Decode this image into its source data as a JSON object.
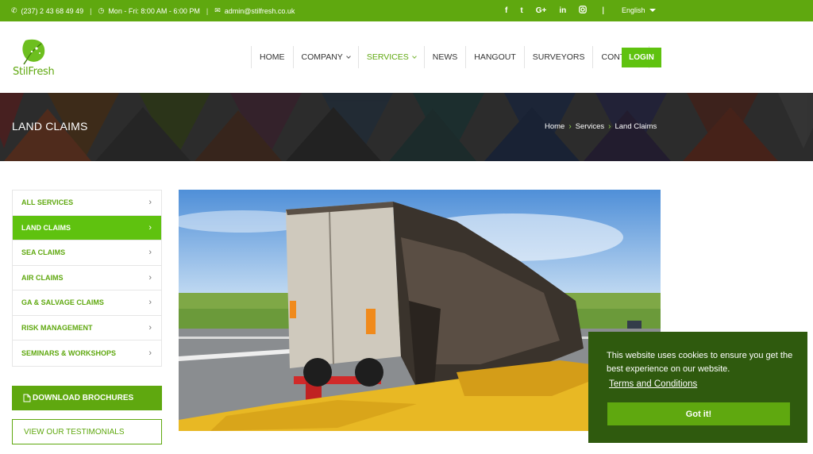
{
  "topbar": {
    "phone": "(237) 2 43 68 49 49",
    "hours": "Mon - Fri: 8:00 AM - 6:00 PM",
    "email": "admin@stilfresh.co.uk",
    "social": [
      "f",
      "t",
      "G+",
      "in",
      "ig"
    ],
    "language": "English"
  },
  "logo": {
    "text": "StilFresh"
  },
  "nav": {
    "items": [
      {
        "label": "HOME",
        "dropdown": false,
        "active": false
      },
      {
        "label": "COMPANY",
        "dropdown": true,
        "active": false
      },
      {
        "label": "SERVICES",
        "dropdown": true,
        "active": true
      },
      {
        "label": "NEWS",
        "dropdown": false,
        "active": false
      },
      {
        "label": "HANGOUT",
        "dropdown": false,
        "active": false
      },
      {
        "label": "SURVEYORS",
        "dropdown": false,
        "active": false
      },
      {
        "label": "CONTACT",
        "dropdown": false,
        "active": false
      }
    ],
    "login": "LOGIN"
  },
  "banner": {
    "title": "LAND CLAIMS",
    "breadcrumb": [
      "Home",
      "Services",
      "Land Claims"
    ]
  },
  "sidebar": {
    "items": [
      {
        "label": "ALL SERVICES",
        "active": false
      },
      {
        "label": "LAND CLAIMS",
        "active": true
      },
      {
        "label": "SEA CLAIMS",
        "active": false
      },
      {
        "label": "AIR CLAIMS",
        "active": false
      },
      {
        "label": "GA & SALVAGE CLAIMS",
        "active": false
      },
      {
        "label": "RISK MANAGEMENT",
        "active": false
      },
      {
        "label": "SEMINARS & WORKSHOPS",
        "active": false
      }
    ],
    "brochure": "DOWNLOAD BROCHURES",
    "testimonials": "VIEW OUR TESTIMONIALS"
  },
  "cookie": {
    "message": "This website uses cookies to ensure you get the best experience on our website.",
    "link": "Terms and Conditions",
    "button": "Got it!"
  },
  "colors": {
    "brand": "#5fa80f",
    "brand_bright": "#5fc20f",
    "cookie_bg": "#2f5a0e"
  }
}
